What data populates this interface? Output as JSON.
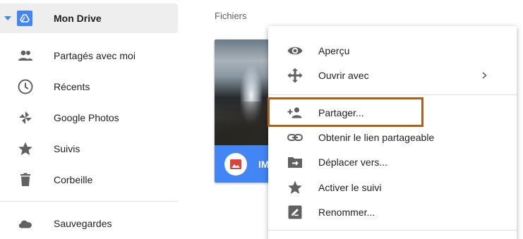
{
  "sidebar": {
    "items": [
      {
        "label": "Mon Drive",
        "icon": "drive-icon"
      },
      {
        "label": "Partagés avec moi",
        "icon": "people-icon"
      },
      {
        "label": "Récents",
        "icon": "clock-icon"
      },
      {
        "label": "Google Photos",
        "icon": "pinwheel-icon"
      },
      {
        "label": "Suivis",
        "icon": "star-icon"
      },
      {
        "label": "Corbeille",
        "icon": "trash-icon"
      },
      {
        "label": "Sauvegardes",
        "icon": "cloud-icon"
      }
    ]
  },
  "main": {
    "section_title": "Fichiers",
    "file": {
      "name": "IM",
      "type_icon": "image-icon"
    }
  },
  "context_menu": {
    "items": [
      {
        "label": "Aperçu",
        "icon": "eye-icon"
      },
      {
        "label": "Ouvrir avec",
        "icon": "move-arrows-icon",
        "has_submenu": true
      },
      {
        "label": "Partager...",
        "icon": "add-person-icon",
        "highlighted": true
      },
      {
        "label": "Obtenir le lien partageable",
        "icon": "link-icon"
      },
      {
        "label": "Déplacer vers...",
        "icon": "folder-move-icon"
      },
      {
        "label": "Activer le suivi",
        "icon": "star-icon"
      },
      {
        "label": "Renommer...",
        "icon": "rename-icon"
      }
    ]
  },
  "colors": {
    "accent": "#4285f4",
    "icon_gray": "#616161",
    "highlight_border": "#b35f1b",
    "active_bg": "#eeeeee"
  }
}
